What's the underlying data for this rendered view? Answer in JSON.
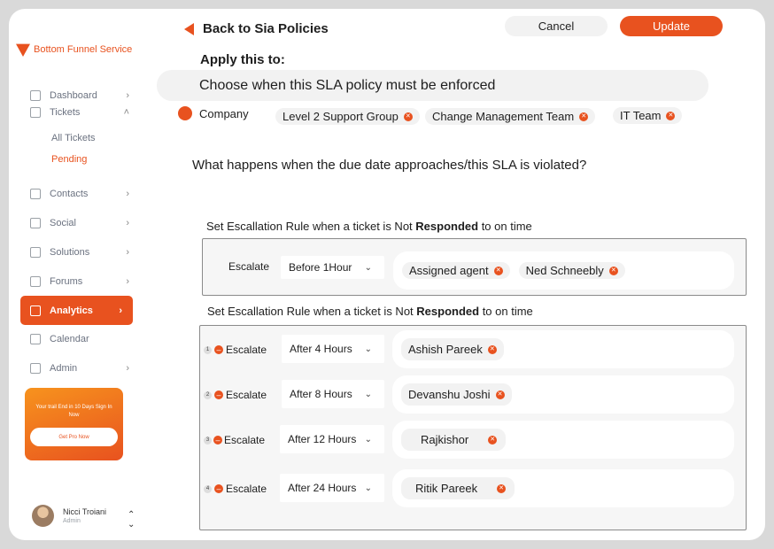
{
  "brand": {
    "name": "Bottom Funnel Service"
  },
  "sidebar": {
    "items": [
      {
        "label": "Dashboard",
        "icon": "chart-line-icon"
      },
      {
        "label": "Tickets",
        "icon": "ticket-icon"
      },
      {
        "label": "Contacts",
        "icon": "contacts-icon"
      },
      {
        "label": "Social",
        "icon": "social-icon"
      },
      {
        "label": "Solutions",
        "icon": "solutions-icon"
      },
      {
        "label": "Forums",
        "icon": "forums-icon"
      },
      {
        "label": "Analytics",
        "icon": "analytics-icon",
        "active": true
      },
      {
        "label": "Calendar",
        "icon": "calendar-icon"
      },
      {
        "label": "Admin",
        "icon": "lock-icon"
      }
    ],
    "tickets_sub": [
      "All Tickets",
      "Pending"
    ],
    "promo": {
      "text": "Your trail End in 10 Days Sign In Now",
      "button": "Get Pro Now"
    },
    "user": {
      "name": "Nicci Troiani",
      "role": "Admin"
    }
  },
  "header": {
    "back_label": "Back to Sia Policies",
    "cancel_label": "Cancel",
    "update_label": "Update"
  },
  "apply": {
    "heading": "Apply this to:",
    "choose_text": "Choose when this SLA policy must be enforced",
    "company_label": "Company",
    "chips": [
      "Level 2 Support Group",
      "Change Management Team",
      "IT Team"
    ]
  },
  "question": "What happens when the due date approaches/this SLA is violated?",
  "rule1": {
    "title_prefix": "Set Escallation Rule when a ticket is Not ",
    "title_bold": "Responded",
    "title_suffix": " to on time",
    "escalate_label": "Escalate",
    "select_value": "Before 1Hour",
    "assignees": [
      "Assigned agent",
      "Ned Schneebly"
    ]
  },
  "rule2": {
    "title_prefix": "Set Escallation Rule when a ticket is Not ",
    "title_bold": "Responded",
    "title_suffix": " to on time",
    "rows": [
      {
        "num": "1",
        "escalate_label": "Escalate",
        "select_value": "After 4 Hours",
        "assignee": "Ashish Pareek"
      },
      {
        "num": "2",
        "escalate_label": "Escalate",
        "select_value": "After 8 Hours",
        "assignee": "Devanshu Joshi"
      },
      {
        "num": "3",
        "escalate_label": "Escalate",
        "select_value": "After 12 Hours",
        "assignee": "Rajkishor"
      },
      {
        "num": "4",
        "escalate_label": "Escalate",
        "select_value": "After 24 Hours",
        "assignee": "Ritik Pareek"
      }
    ]
  },
  "colors": {
    "accent": "#e8521f",
    "chip_bg": "#f2f2f2"
  }
}
